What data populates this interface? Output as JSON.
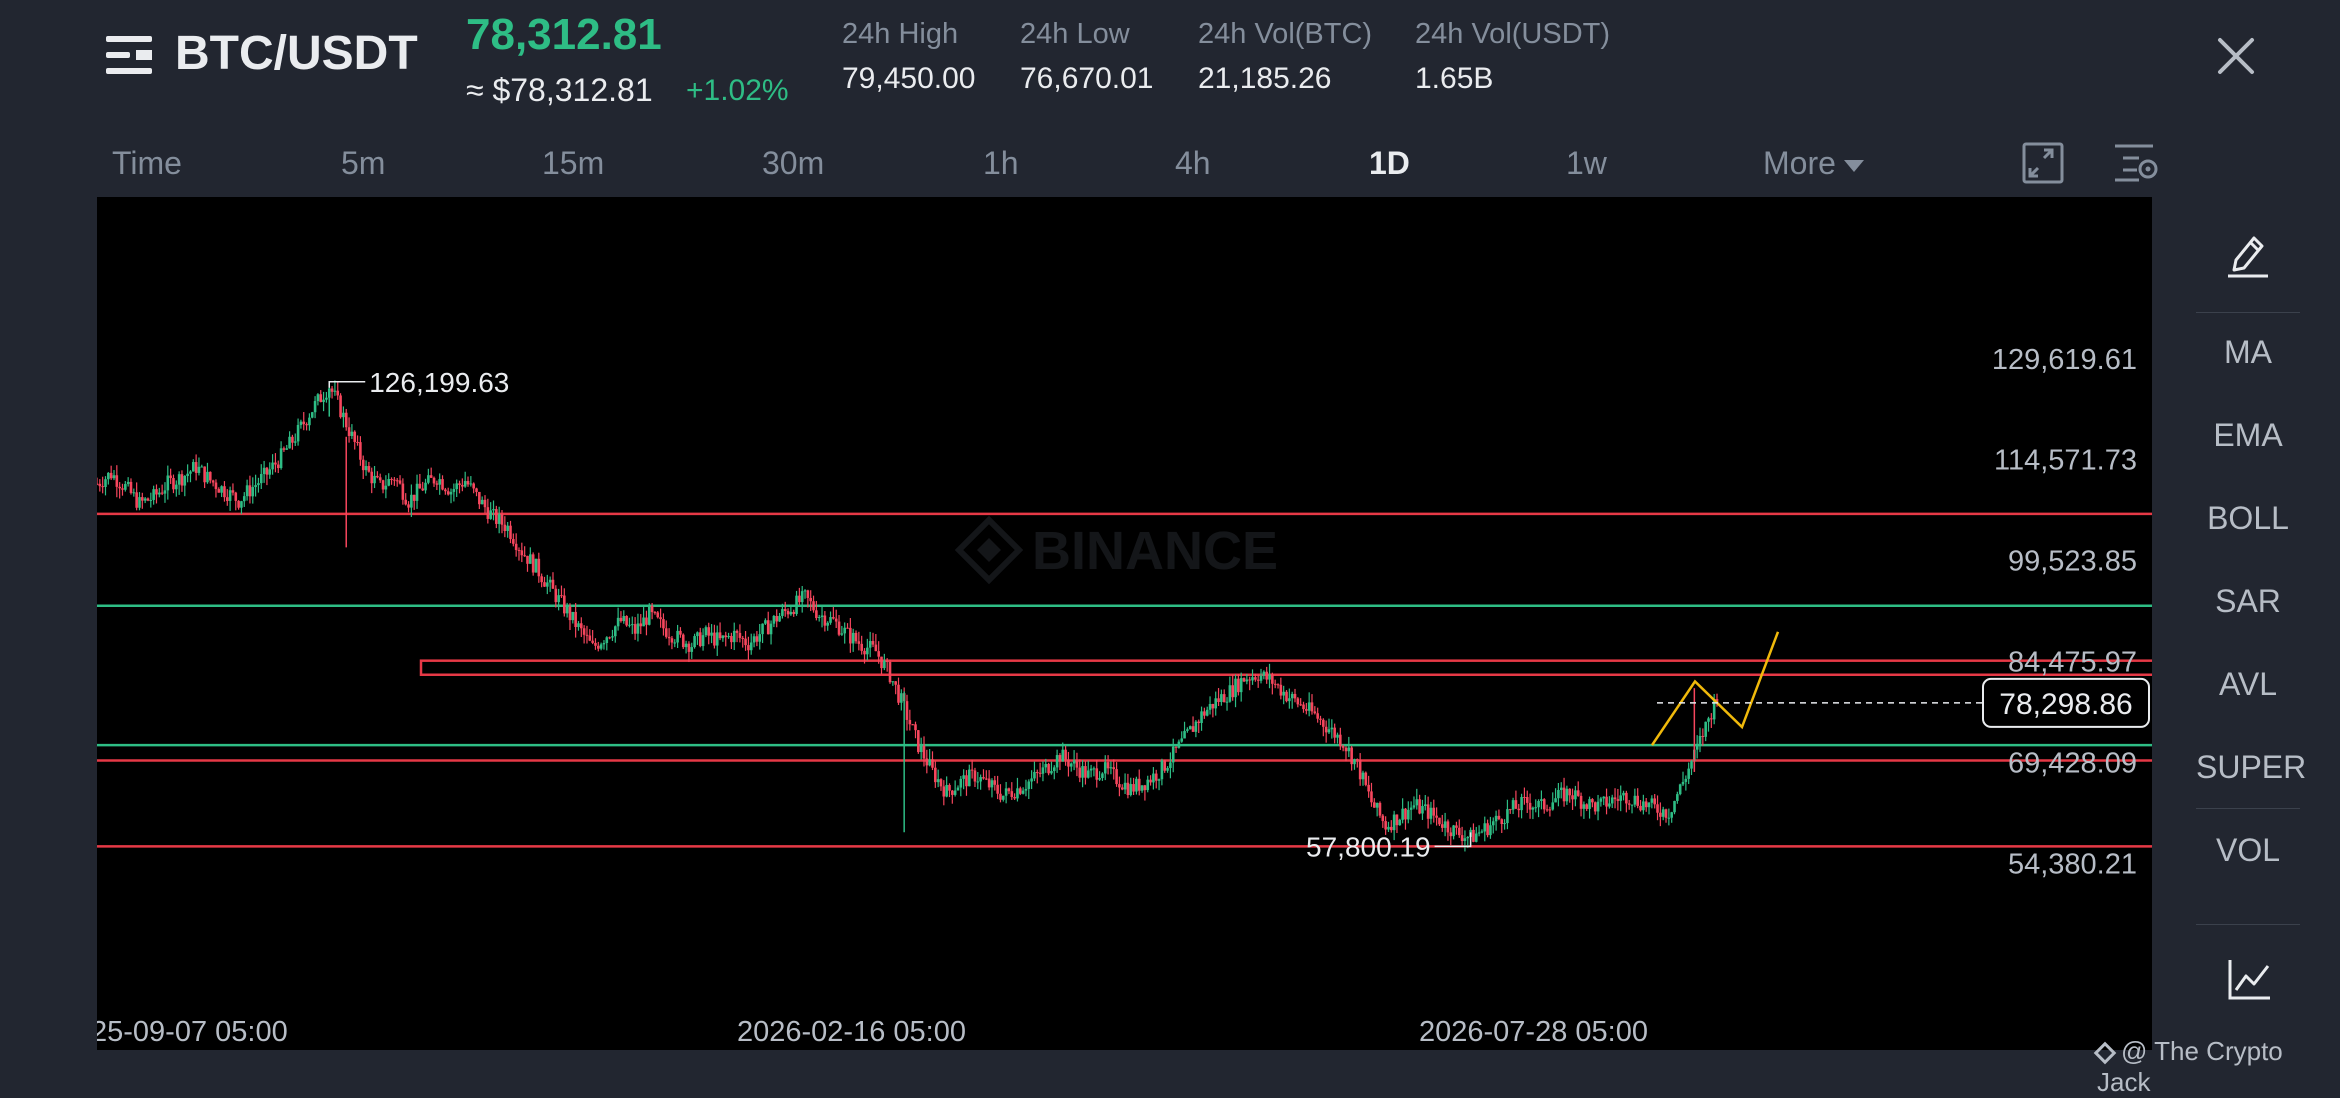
{
  "header": {
    "pair": "BTC/USDT",
    "last_price": "78,312.81",
    "approx_usd": "≈ $78,312.81",
    "change_pct": "+1.02%",
    "stats": [
      {
        "label": "24h High",
        "value": "79,450.00"
      },
      {
        "label": "24h Low",
        "value": "76,670.01"
      },
      {
        "label": "24h Vol(BTC)",
        "value": "21,185.26"
      },
      {
        "label": "24h Vol(USDT)",
        "value": "1.65B"
      }
    ]
  },
  "timeframes": {
    "items": [
      "Time",
      "5m",
      "15m",
      "30m",
      "1h",
      "4h",
      "1D",
      "1w",
      "More"
    ],
    "active": "1D"
  },
  "indicators": [
    "MA",
    "EMA",
    "BOLL",
    "SAR",
    "AVL",
    "SUPER",
    "VOL"
  ],
  "chart_watermark": "BINANCE",
  "credit": "@ The Crypto Jack",
  "colors": {
    "up": "#2ebd85",
    "down": "#f6465d",
    "level_red": "#e63946",
    "level_green": "#2ebd85",
    "projection": "#f0b90b",
    "background": "#222630",
    "chart_bg": "#000000"
  },
  "chart_data": {
    "type": "candlestick",
    "price_scale_labels": [
      "129,619.61",
      "114,571.73",
      "99,523.85",
      "84,475.97",
      "69,428.09",
      "54,380.21"
    ],
    "price_scale_values": [
      129619.61,
      114571.73,
      99523.85,
      84475.97,
      69428.09,
      54380.21
    ],
    "time_labels": [
      "25-09-07 05:00",
      "2026-02-16 05:00",
      "2026-07-28 05:00"
    ],
    "high_marker": {
      "label": "126,199.63",
      "value": 126199.63
    },
    "low_marker": {
      "label": "57,800.19",
      "value": 57800.19
    },
    "current_price": {
      "label": "78,298.86",
      "value": 78298.86
    },
    "horizontal_levels": [
      {
        "value": 106500,
        "color": "red"
      },
      {
        "value": 92800,
        "color": "green"
      },
      {
        "value": 72000,
        "color": "green"
      },
      {
        "value": 69700,
        "color": "red"
      },
      {
        "value": 56900,
        "color": "red"
      }
    ],
    "zone": {
      "low": 82500,
      "high": 84600,
      "color": "red"
    },
    "projection_path": [
      72000,
      81500,
      74700,
      88900
    ],
    "price_path": [
      [
        0,
        111000
      ],
      [
        5,
        112500
      ],
      [
        10,
        110500
      ],
      [
        15,
        108000
      ],
      [
        20,
        109000
      ],
      [
        25,
        111000
      ],
      [
        30,
        112000
      ],
      [
        35,
        113500
      ],
      [
        40,
        111500
      ],
      [
        45,
        110000
      ],
      [
        50,
        108500
      ],
      [
        55,
        110500
      ],
      [
        60,
        112500
      ],
      [
        65,
        115000
      ],
      [
        70,
        118000
      ],
      [
        75,
        121500
      ],
      [
        80,
        124500
      ],
      [
        82,
        125600
      ],
      [
        85,
        123000
      ],
      [
        90,
        118000
      ],
      [
        95,
        113000
      ],
      [
        100,
        110500
      ],
      [
        105,
        112000
      ],
      [
        110,
        108500
      ],
      [
        115,
        110500
      ],
      [
        120,
        112000
      ],
      [
        125,
        110000
      ],
      [
        130,
        111500
      ],
      [
        135,
        108500
      ],
      [
        140,
        106000
      ],
      [
        145,
        104500
      ],
      [
        150,
        101000
      ],
      [
        155,
        98500
      ],
      [
        160,
        95500
      ],
      [
        165,
        92500
      ],
      [
        170,
        89500
      ],
      [
        175,
        86500
      ],
      [
        180,
        88500
      ],
      [
        185,
        90500
      ],
      [
        190,
        89000
      ],
      [
        195,
        91500
      ],
      [
        200,
        89500
      ],
      [
        205,
        88000
      ],
      [
        210,
        87000
      ],
      [
        215,
        88500
      ],
      [
        220,
        87500
      ],
      [
        225,
        88500
      ],
      [
        230,
        87200
      ],
      [
        235,
        89000
      ],
      [
        240,
        91000
      ],
      [
        245,
        92500
      ],
      [
        250,
        94000
      ],
      [
        255,
        91500
      ],
      [
        260,
        90500
      ],
      [
        265,
        88500
      ],
      [
        270,
        87000
      ],
      [
        275,
        86000
      ],
      [
        280,
        82500
      ],
      [
        285,
        77500
      ],
      [
        290,
        72000
      ],
      [
        295,
        68000
      ],
      [
        300,
        65000
      ],
      [
        305,
        66500
      ],
      [
        310,
        67500
      ],
      [
        315,
        66000
      ],
      [
        320,
        64500
      ],
      [
        325,
        65500
      ],
      [
        330,
        66800
      ],
      [
        335,
        68500
      ],
      [
        340,
        70500
      ],
      [
        345,
        69000
      ],
      [
        350,
        67500
      ],
      [
        355,
        68500
      ],
      [
        360,
        67000
      ],
      [
        365,
        65500
      ],
      [
        370,
        66500
      ],
      [
        375,
        68000
      ],
      [
        380,
        70500
      ],
      [
        385,
        73500
      ],
      [
        390,
        76500
      ],
      [
        395,
        78500
      ],
      [
        400,
        80000
      ],
      [
        405,
        82000
      ],
      [
        410,
        82600
      ],
      [
        415,
        81500
      ],
      [
        420,
        79500
      ],
      [
        425,
        78000
      ],
      [
        430,
        76500
      ],
      [
        435,
        74500
      ],
      [
        440,
        72500
      ],
      [
        445,
        69000
      ],
      [
        450,
        63500
      ],
      [
        455,
        60000
      ],
      [
        460,
        61500
      ],
      [
        465,
        63000
      ],
      [
        470,
        62000
      ],
      [
        475,
        60500
      ],
      [
        480,
        59000
      ],
      [
        485,
        58200
      ],
      [
        490,
        59500
      ],
      [
        495,
        61000
      ],
      [
        500,
        62500
      ],
      [
        505,
        63500
      ],
      [
        510,
        62800
      ],
      [
        515,
        64000
      ],
      [
        520,
        65000
      ],
      [
        525,
        63500
      ],
      [
        530,
        62800
      ],
      [
        535,
        63800
      ],
      [
        540,
        64500
      ],
      [
        545,
        63500
      ],
      [
        550,
        62600
      ],
      [
        555,
        62000
      ],
      [
        560,
        66500
      ],
      [
        565,
        71500
      ],
      [
        570,
        77000
      ],
      [
        572,
        79500
      ]
    ]
  }
}
